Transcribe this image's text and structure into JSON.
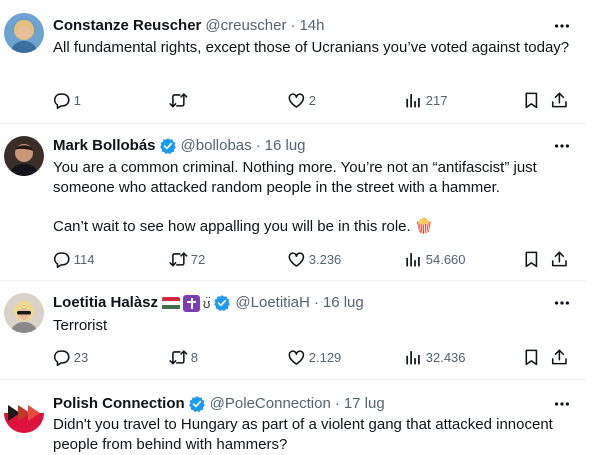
{
  "colors": {
    "text": "#0f1419",
    "secondary": "#536471",
    "verified": "#1d9bf0",
    "divider": "#eff3f4"
  },
  "icons": {
    "reply": "reply-icon",
    "retweet": "retweet-icon",
    "like": "heart-icon",
    "views": "views-icon",
    "bookmark": "bookmark-icon",
    "share": "share-icon",
    "more": "more-icon",
    "verified": "verified-badge-icon"
  },
  "tweets": [
    {
      "name": "Constanze Reuscher",
      "handle": "@creuscher",
      "separator": "·",
      "time": "14h",
      "text": [
        "All fundamental rights, except those of Ucranians you’ve voted against today?"
      ],
      "replies": "1",
      "retweets": "",
      "likes": "2",
      "views": "217"
    },
    {
      "name": "Mark Bollobás",
      "handle": "@bollobas",
      "separator": "·",
      "time": "16 lug",
      "text": [
        "You are a common criminal. Nothing more. You’re not an “antifascist” just someone who attacked random people in the street with a hammer.",
        "Can’t wait to see how appalling you will be in this role. 🍿"
      ],
      "replies": "114",
      "retweets": "72",
      "likes": "3.236",
      "views": "54.660"
    },
    {
      "name": "Loetitia Halàsz",
      "name_suffix": "ʊ̈",
      "handle": "@LoetitiaH",
      "separator": "·",
      "time": "16 lug",
      "text": [
        "Terrorist"
      ],
      "replies": "23",
      "retweets": "8",
      "likes": "2.129",
      "views": "32.436"
    },
    {
      "name": "Polish Connection",
      "handle": "@PoleConnection",
      "separator": "·",
      "time": "17 lug",
      "text": [
        "Didn't you travel to Hungary as part of a violent gang that attacked innocent people from behind with hammers?"
      ]
    }
  ]
}
